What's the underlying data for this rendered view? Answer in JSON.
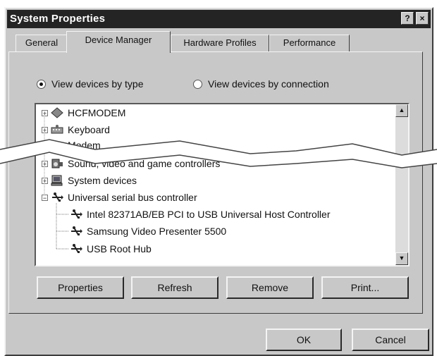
{
  "window": {
    "title": "System Properties",
    "help_button": "?",
    "close_button": "×"
  },
  "tabs": [
    {
      "label": "General"
    },
    {
      "label": "Device Manager"
    },
    {
      "label": "Hardware Profiles"
    },
    {
      "label": "Performance"
    }
  ],
  "view_options": {
    "by_type": "View devices by type",
    "by_connection": "View devices by connection",
    "selected": "by_type"
  },
  "device_tree": [
    {
      "label": "HCFMODEM",
      "expander": "+",
      "icon": "modem-icon"
    },
    {
      "label": "Keyboard",
      "expander": "+",
      "icon": "keyboard-icon"
    },
    {
      "label": "Modem",
      "expander": "+",
      "icon": "modem-icon"
    },
    {
      "label": "Sound, video and game controllers",
      "expander": "+",
      "icon": "sound-icon"
    },
    {
      "label": "System devices",
      "expander": "+",
      "icon": "computer-icon"
    },
    {
      "label": "Universal serial bus controller",
      "expander": "−",
      "icon": "usb-icon"
    },
    {
      "label": "Intel 82371AB/EB PCI to USB Universal Host Controller",
      "icon": "usb-icon"
    },
    {
      "label": "Samsung Video Presenter 5500",
      "icon": "usb-icon"
    },
    {
      "label": "USB Root Hub",
      "icon": "usb-icon"
    }
  ],
  "buttons": {
    "properties": "Properties",
    "refresh": "Refresh",
    "remove": "Remove",
    "print": "Print...",
    "ok": "OK",
    "cancel": "Cancel"
  }
}
